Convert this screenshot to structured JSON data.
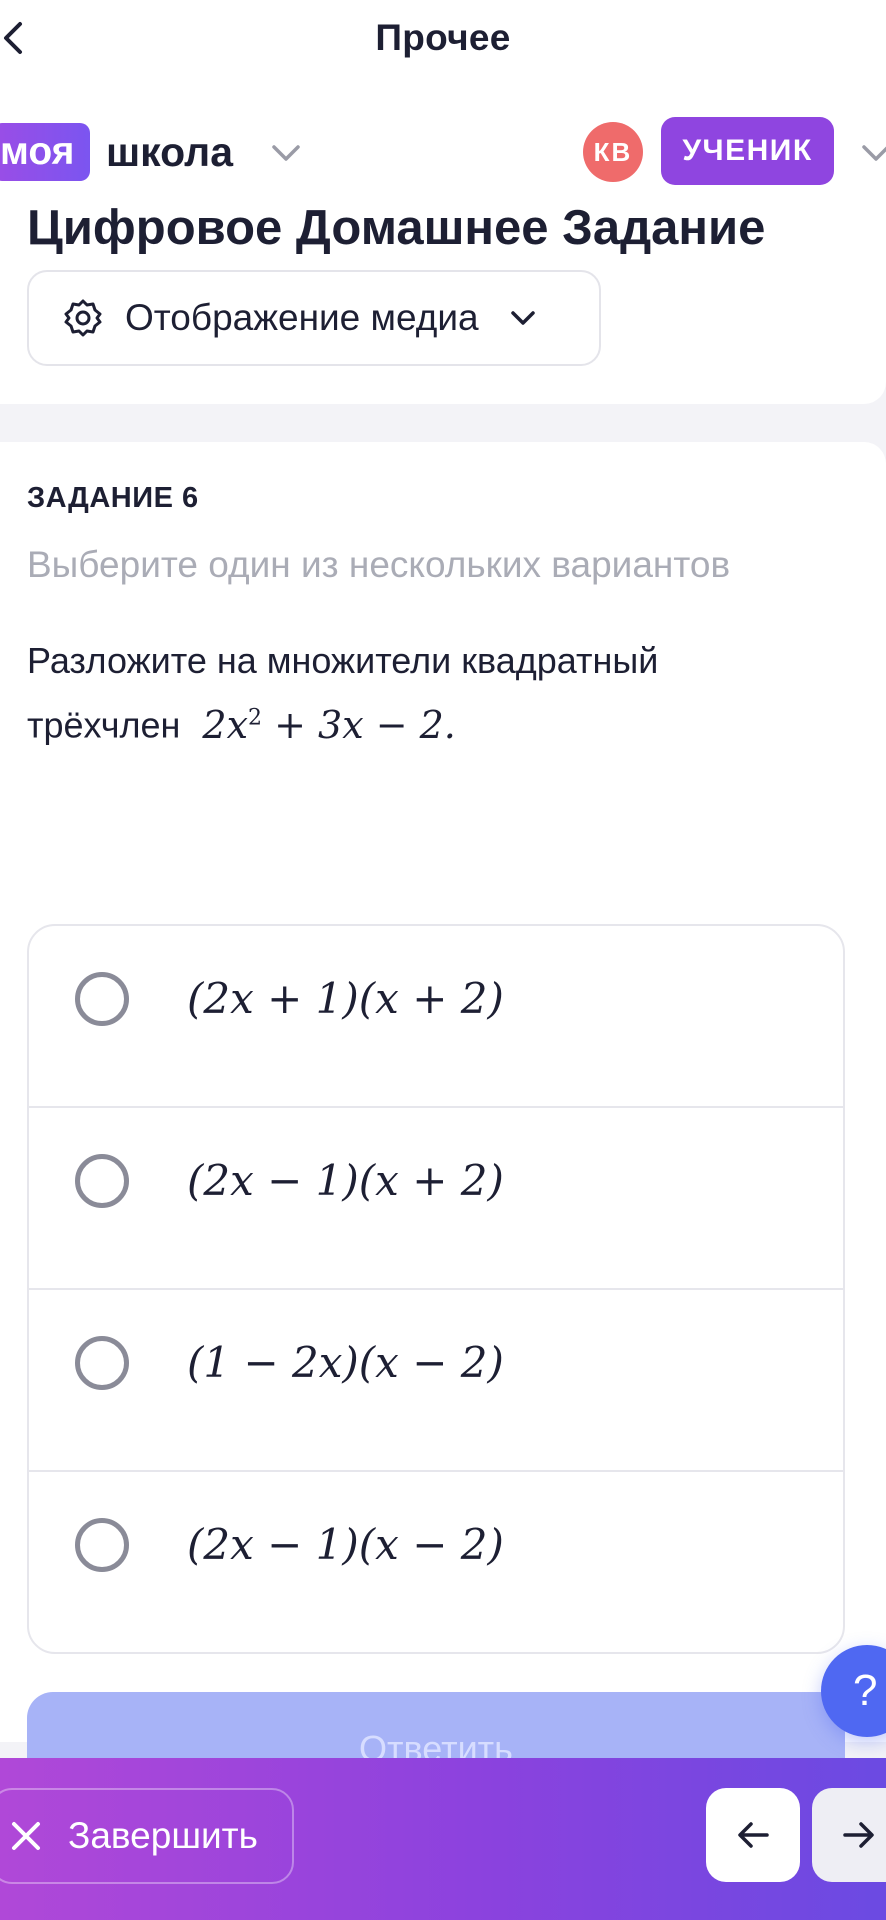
{
  "nav": {
    "title": "Прочее"
  },
  "header": {
    "logo_pill": "моя",
    "logo_text": "школа",
    "avatar_initials": "КВ",
    "role": "УЧЕНИК"
  },
  "page": {
    "title": "Цифровое Домашнее Задание",
    "media_button": "Отображение медиа"
  },
  "task": {
    "title": "ЗАДАНИЕ 6",
    "hint": "Выберите один из нескольких вариантов",
    "text_line1": "Разложите на множители квадратный",
    "text_line2": "трёхчлен",
    "expr_a": "2x",
    "expr_exp": "2",
    "expr_b": " + 3x − 2."
  },
  "options": [
    {
      "text": "(2x + 1)(x + 2)",
      "selected": false
    },
    {
      "text": "(2x − 1)(x + 2)",
      "selected": false
    },
    {
      "text": "(1 − 2x)(x − 2)",
      "selected": false
    },
    {
      "text": "(2x − 1)(x − 2)",
      "selected": false
    }
  ],
  "answer_button": "Ответить",
  "help_button": "?",
  "bottom": {
    "finish_label": "Завершить"
  },
  "colors": {
    "accent": "#8f45e0",
    "primary": "#4f68f2",
    "avatar": "#ef6b6b"
  }
}
